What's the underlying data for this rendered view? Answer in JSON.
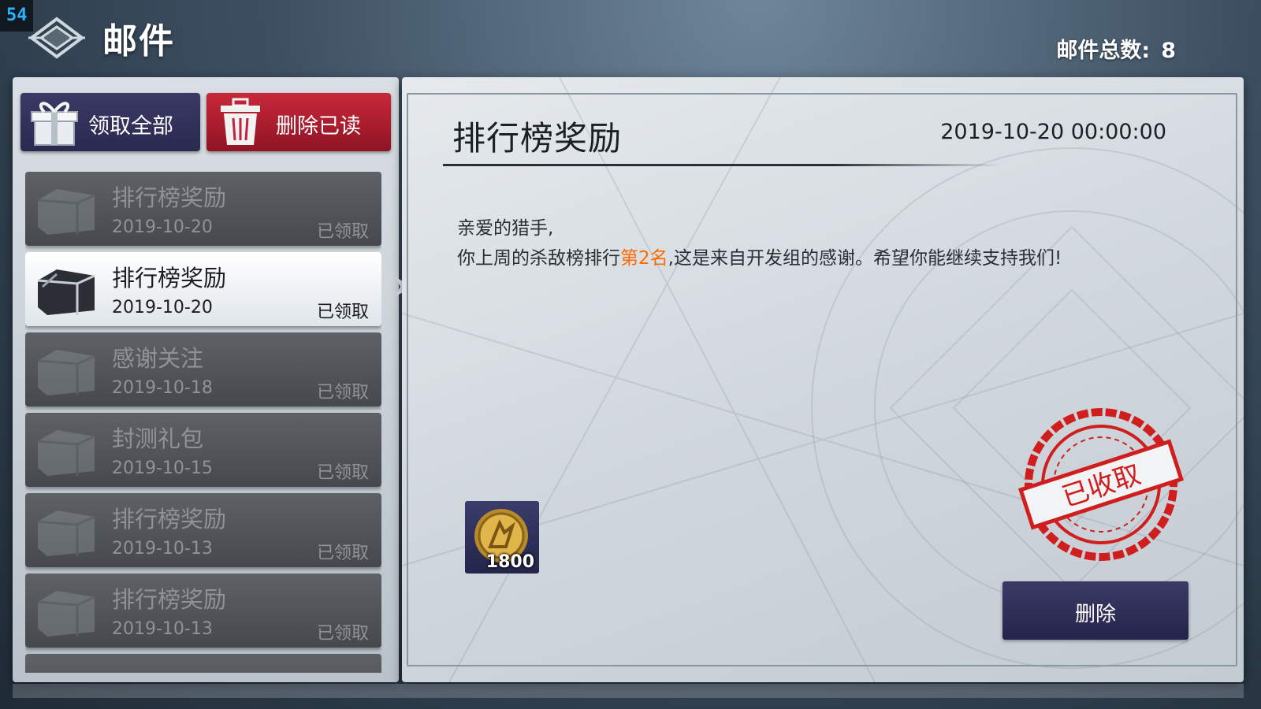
{
  "hud": {
    "fps": "54"
  },
  "header": {
    "title": "邮件",
    "total_label": "邮件总数:",
    "total_count": "8"
  },
  "actions": {
    "claim_all": "领取全部",
    "delete_read": "删除已读"
  },
  "mails": [
    {
      "title": "排行榜奖励",
      "date": "2019-10-20",
      "status": "已领取"
    },
    {
      "title": "排行榜奖励",
      "date": "2019-10-20",
      "status": "已领取"
    },
    {
      "title": "感谢关注",
      "date": "2019-10-18",
      "status": "已领取"
    },
    {
      "title": "封测礼包",
      "date": "2019-10-15",
      "status": "已领取"
    },
    {
      "title": "排行榜奖励",
      "date": "2019-10-13",
      "status": "已领取"
    },
    {
      "title": "排行榜奖励",
      "date": "2019-10-13",
      "status": "已领取"
    }
  ],
  "detail": {
    "title": "排行榜奖励",
    "datetime": "2019-10-20 00:00:00",
    "greeting": "亲爱的猎手,",
    "body_before": "你上周的杀敌榜排行",
    "body_highlight": "第2名",
    "body_after": ",这是来自开发组的感谢。希望你能继续支持我们!",
    "attachment_qty": "1800",
    "stamp_text": "已收取",
    "delete_button": "删除"
  },
  "colors": {
    "highlight": "#ff6a00",
    "stamp": "#d01e1e",
    "button_dark": "#2e2d58",
    "button_red": "#b31e30"
  },
  "icons": [
    "app-logo-icon",
    "gift-box-icon",
    "trash-can-icon",
    "mail-box-icon",
    "gold-coin-icon",
    "received-stamp-icon",
    "selection-arrow-icon"
  ]
}
